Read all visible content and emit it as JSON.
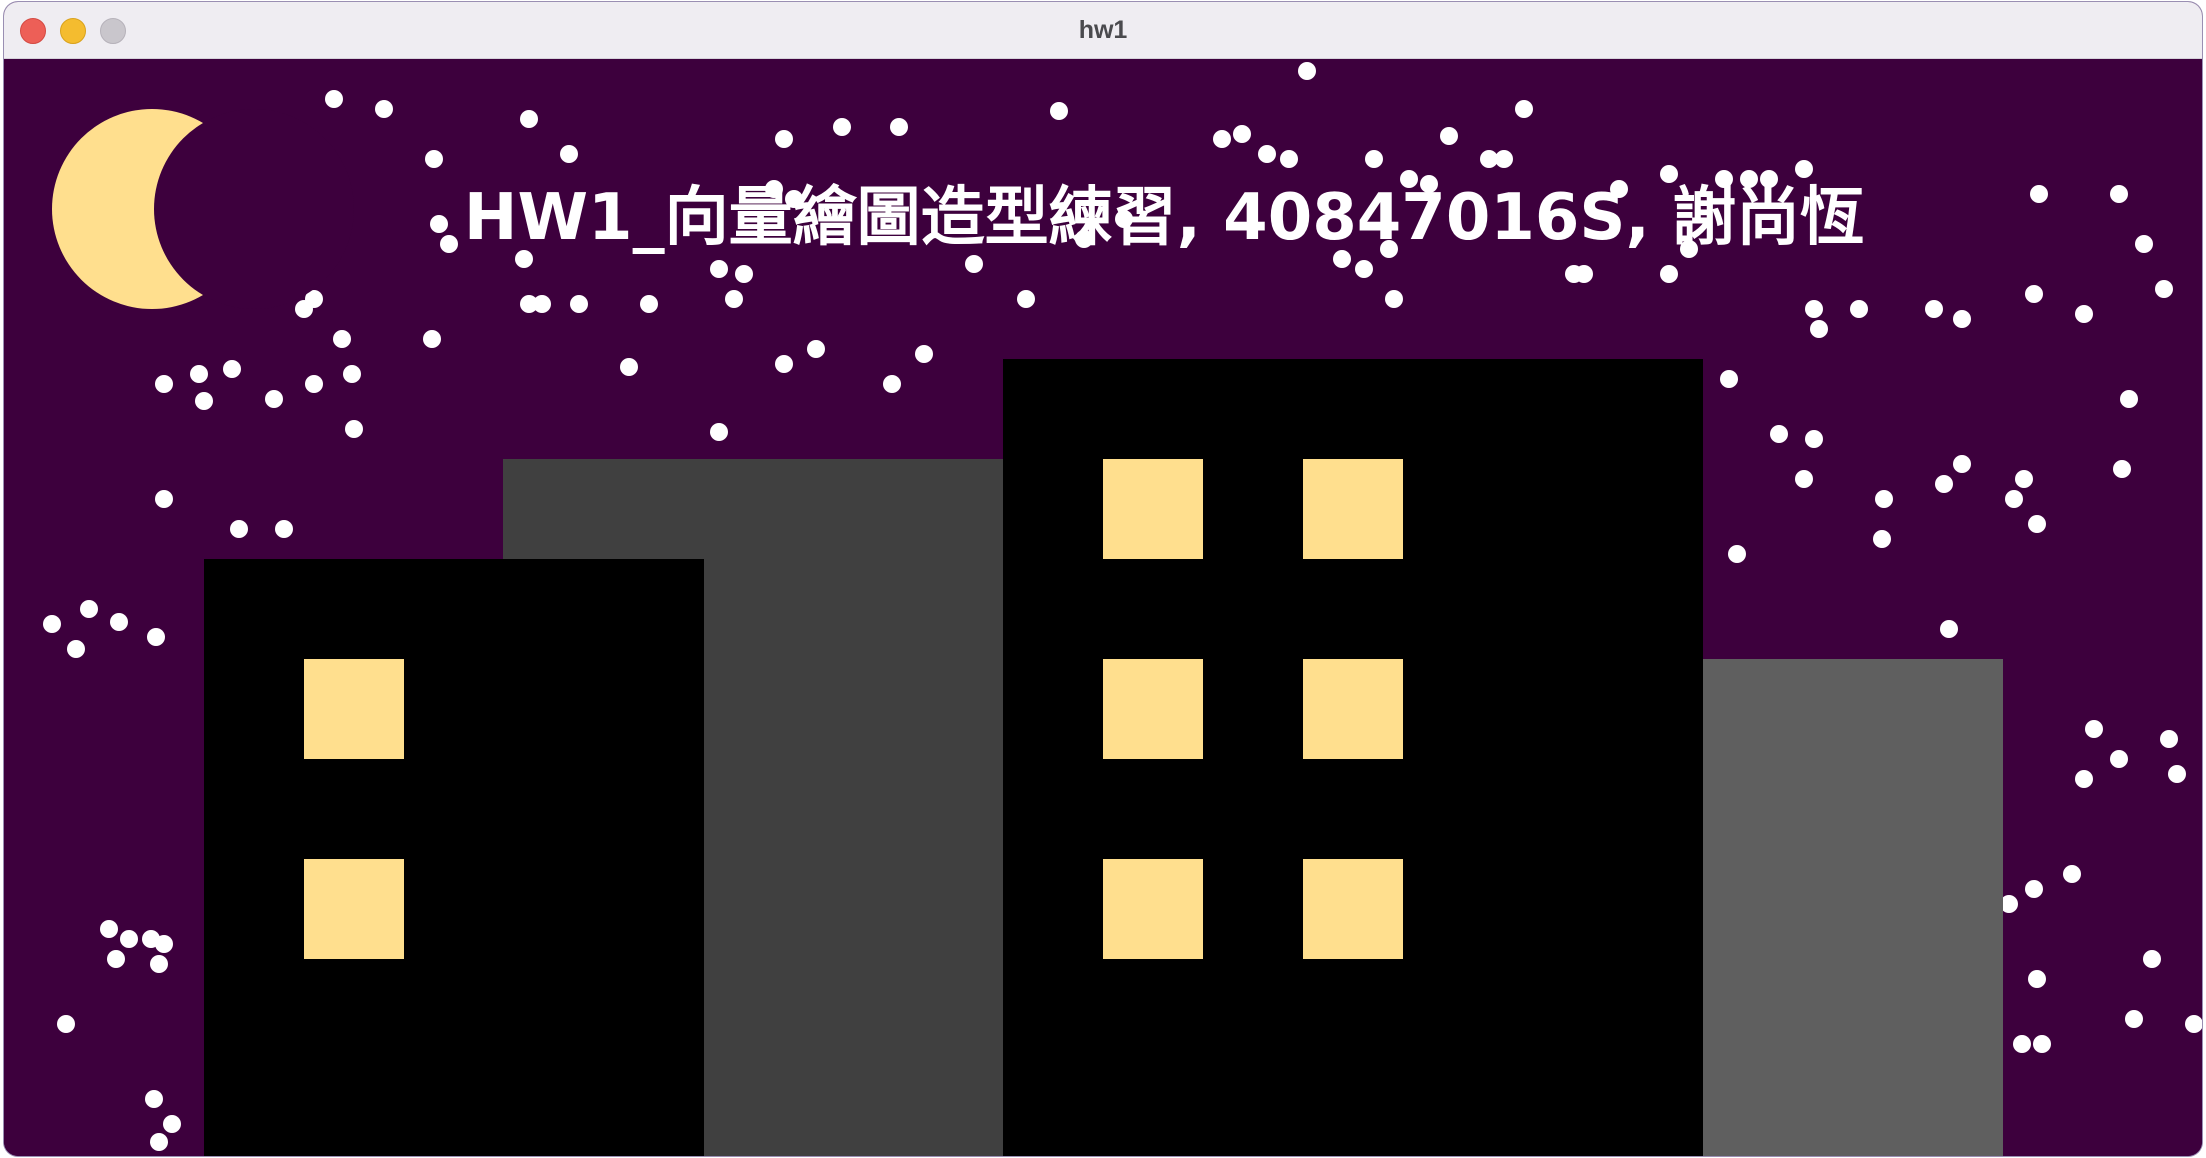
{
  "window": {
    "title": "hw1",
    "controls": [
      "close",
      "minimize",
      "zoom"
    ]
  },
  "scene": {
    "headline": "HW1_向量繪圖造型練習, 40847016S, 謝尚恆",
    "colors": {
      "sky": "#3d003d",
      "moon": "#ffdf8e",
      "window_light": "#ffdf8e",
      "building_black": "#000000",
      "building_dark_gray": "#404040",
      "building_gray": "#5f5f5f",
      "star": "#ffffff"
    },
    "icons": [
      "moon-icon"
    ]
  }
}
